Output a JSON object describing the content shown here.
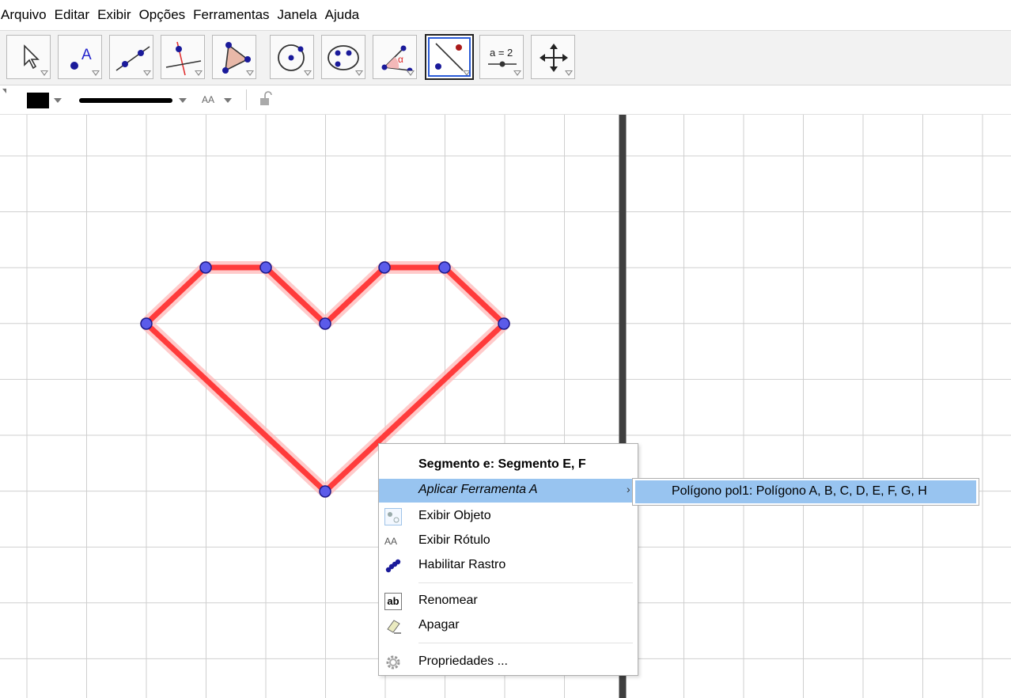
{
  "menubar": [
    "Arquivo",
    "Editar",
    "Exibir",
    "Opções",
    "Ferramentas",
    "Janela",
    "Ajuda"
  ],
  "toolbar": {
    "tools": [
      {
        "name": "move-tool-icon"
      },
      {
        "name": "point-tool-icon",
        "text": "A"
      },
      {
        "name": "line-tool-icon"
      },
      {
        "name": "perpendicular-line-tool-icon"
      },
      {
        "name": "polygon-tool-icon"
      },
      {
        "name": "circle-tool-icon"
      },
      {
        "name": "ellipse-tool-icon"
      },
      {
        "name": "angle-tool-icon",
        "text": "α"
      },
      {
        "name": "reflect-tool-icon",
        "selected": true
      },
      {
        "name": "slider-tool-icon",
        "text": "a = 2"
      },
      {
        "name": "move-graphics-tool-icon"
      }
    ]
  },
  "stylebar": {
    "color": "#000000",
    "text_size_label": "AA"
  },
  "colors": {
    "shape_stroke": "#ff3b3b",
    "shape_halo": "#ffb3b3",
    "point_fill": "#5b5bea",
    "point_stroke": "#1a1a8a",
    "grid": "#cfcfcf",
    "menu_highlight": "#98c4f0"
  },
  "context_menu": {
    "title": "Segmento e: Segmento E, F",
    "items": [
      {
        "label": "Aplicar Ferramenta A",
        "icon": "",
        "italic": true,
        "highlighted": true,
        "submenu": true
      },
      {
        "label": "Exibir Objeto",
        "icon": "show-object-icon"
      },
      {
        "label": "Exibir Rótulo",
        "icon": "show-label-icon",
        "icon_text": "AA"
      },
      {
        "label": "Habilitar Rastro",
        "icon": "trace-icon"
      },
      {
        "label": "Renomear",
        "icon": "rename-icon",
        "icon_text": "ab"
      },
      {
        "label": "Apagar",
        "icon": "eraser-icon"
      },
      {
        "label": "Propriedades ...",
        "icon": "gear-icon"
      }
    ],
    "submenu_item": "Polígono pol1: Polígono A, B, C, D, E, F, G, H"
  }
}
